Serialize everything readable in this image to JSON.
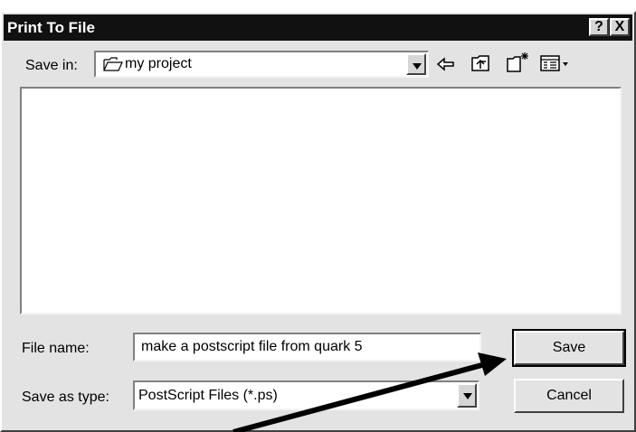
{
  "window": {
    "title": "Print To File",
    "help_label": "?",
    "close_label": "X"
  },
  "save_in": {
    "label": "Save in:",
    "value": "my project"
  },
  "toolbar": {
    "icons": [
      "back-arrow-icon",
      "up-one-level-icon",
      "new-folder-icon",
      "view-menu-icon"
    ]
  },
  "file_name": {
    "label": "File name:",
    "value": "make a postscript file from quark 5"
  },
  "save_as_type": {
    "label": "Save as type:",
    "value": "PostScript Files (*.ps)"
  },
  "buttons": {
    "save": "Save",
    "cancel": "Cancel"
  }
}
